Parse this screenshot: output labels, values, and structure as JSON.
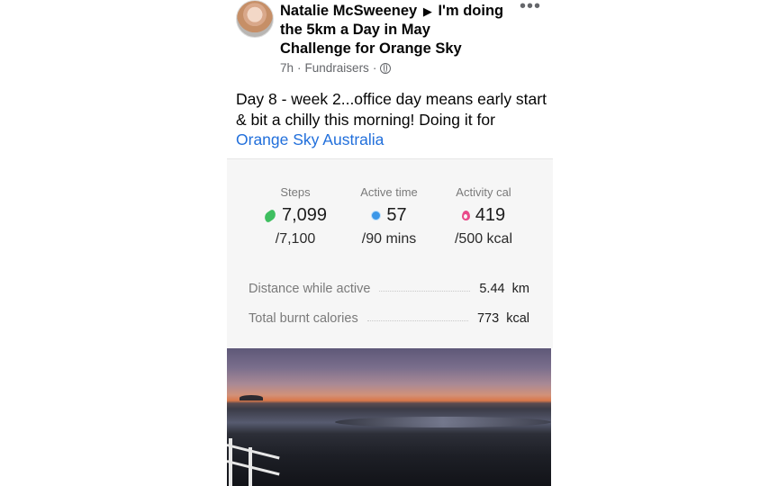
{
  "post": {
    "author": "Natalie McSweeney",
    "arrow": "▶",
    "action": "I'm doing the 5km a Day in May Challenge for Orange Sky",
    "time": "7h",
    "separator": "·",
    "category": "Fundraisers",
    "separator2": "·",
    "more": "•••",
    "text": "Day 8 - week 2...office day means early start & bit a chilly this morning! Doing it for ",
    "link": "Orange Sky Australia"
  },
  "activity": {
    "stats": [
      {
        "label": "Steps",
        "value": "7,099",
        "goal": "/7,100",
        "icon": "shoe-icon",
        "color": "#3fbf60"
      },
      {
        "label": "Active time",
        "value": "57",
        "goal": "/90 mins",
        "icon": "clock-icon",
        "color": "#3b97e8"
      },
      {
        "label": "Activity cal",
        "value": "419",
        "goal": "/500 kcal",
        "icon": "flame-icon",
        "color": "#e9498a"
      }
    ],
    "distance_label": "Distance while active",
    "distance_value": "5.44",
    "distance_unit": "km",
    "burnt_label": "Total burnt calories",
    "burnt_value": "773",
    "burnt_unit": "kcal"
  }
}
